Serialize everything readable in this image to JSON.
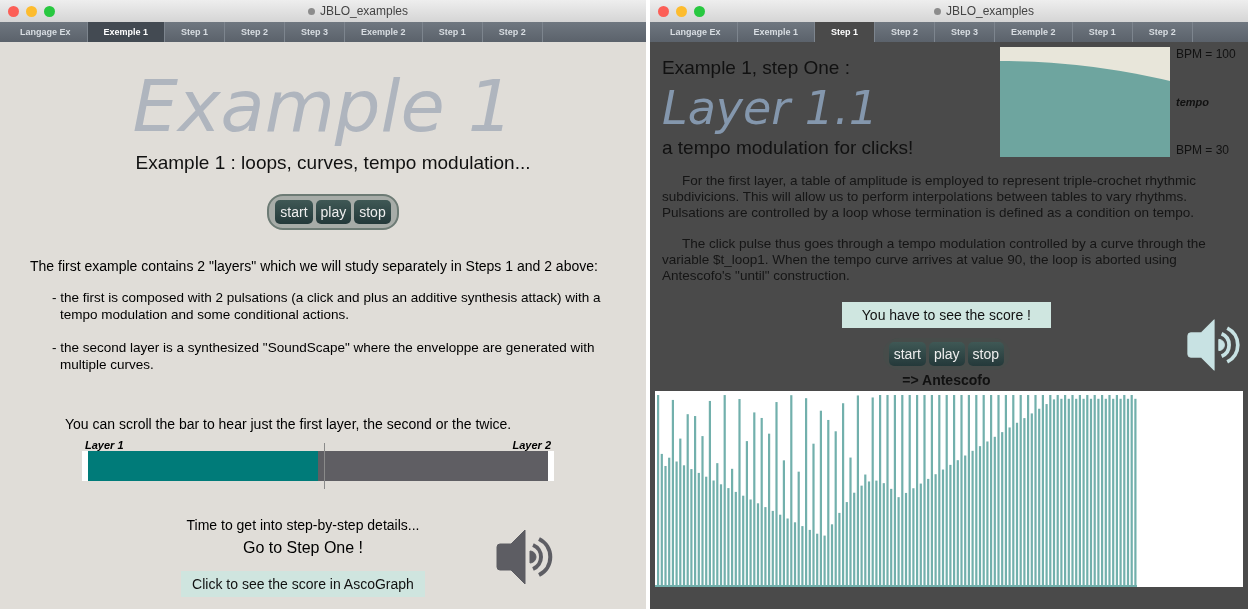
{
  "left_window": {
    "title": "JBLO_examples",
    "tabs": [
      {
        "label": "Langage Ex",
        "selected": false
      },
      {
        "label": "Exemple 1",
        "selected": true
      },
      {
        "label": "Step 1",
        "selected": false
      },
      {
        "label": "Step 2",
        "selected": false
      },
      {
        "label": "Step 3",
        "selected": false
      },
      {
        "label": "Exemple 2",
        "selected": false
      },
      {
        "label": "Step 1",
        "selected": false
      },
      {
        "label": "Step 2",
        "selected": false
      }
    ],
    "big_title": "Example 1",
    "subtitle": "Example 1 : loops, curves, tempo modulation...",
    "transport": [
      "start",
      "play",
      "stop"
    ],
    "intro": "The first example contains 2 \"layers\" which we will study separately in Steps 1 and 2 above:",
    "bullets": [
      "- the first is composed with 2 pulsations (a click and plus an additive synthesis attack) with a tempo modulation and some conditional actions.",
      "- the second layer is a synthesized \"SoundScape\" where the enveloppe are generated with multiple curves."
    ],
    "slider_hint": "You can scroll the bar to hear just the first layer, the second or the twice.",
    "slider": {
      "left_label": "Layer 1",
      "right_label": "Layer 2",
      "level": 0.5
    },
    "next_hint": "Time to get into step-by-step details...",
    "next_link": "Go to Step One !",
    "score_button": "Click to see the score in AscoGraph"
  },
  "right_window": {
    "title": "JBLO_examples",
    "tabs": [
      {
        "label": "Langage Ex",
        "selected": false
      },
      {
        "label": "Exemple 1",
        "selected": false
      },
      {
        "label": "Step 1",
        "selected": true
      },
      {
        "label": "Step 2",
        "selected": false
      },
      {
        "label": "Step 3",
        "selected": false
      },
      {
        "label": "Exemple 2",
        "selected": false
      },
      {
        "label": "Step 1",
        "selected": false
      },
      {
        "label": "Step 2",
        "selected": false
      }
    ],
    "heading": "Example 1, step One :",
    "big_title": "Layer 1.1",
    "subtitle": "a tempo modulation for clicks!",
    "tempo_labels": {
      "top": "BPM = 100",
      "middle": "tempo",
      "bottom": "BPM = 30"
    },
    "paragraphs": [
      "For the first layer, a table of amplitude is employed to represent triple-crochet rhythmic subdivicions. This will allow us to perform interpolations between tables to vary rhythms. Pulsations are controlled by a loop whose termination is defined as a condition on tempo.",
      "The click pulse thus goes through a tempo modulation controlled by a curve through the variable $t_loop1. When the tempo curve arrives at value 90, the loop is aborted using Antescofo's \"until\" construction."
    ],
    "score_button": "You have to see the score !",
    "transport": [
      "start",
      "play",
      "stop"
    ],
    "caption": "=> Antescofo"
  }
}
